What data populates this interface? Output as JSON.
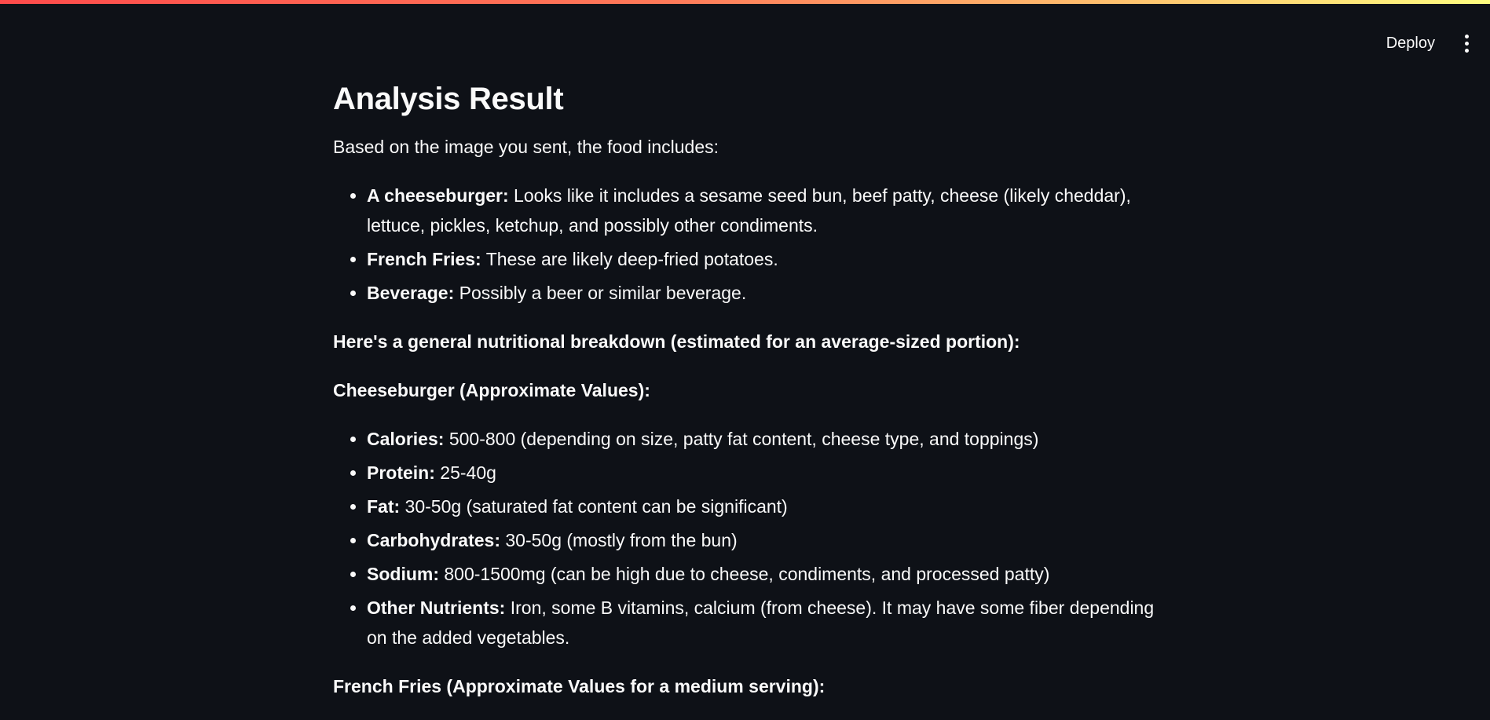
{
  "header": {
    "deploy_label": "Deploy",
    "menu_icon": "vertical-ellipsis-icon",
    "decoration_colors": [
      "#ff4b4b",
      "#fffd80"
    ]
  },
  "main": {
    "title": "Analysis Result",
    "intro": "Based on the image you sent, the food includes:",
    "foods": [
      {
        "label": "A cheeseburger:",
        "text": " Looks like it includes a sesame seed bun, beef patty, cheese (likely cheddar), lettuce, pickles, ketchup, and possibly other condiments."
      },
      {
        "label": "French Fries:",
        "text": " These are likely deep-fried potatoes."
      },
      {
        "label": "Beverage:",
        "text": " Possibly a beer or similar beverage."
      }
    ],
    "breakdown_heading": "Here's a general nutritional breakdown (estimated for an average-sized portion):",
    "cheeseburger_heading": "Cheeseburger (Approximate Values):",
    "cheeseburger_items": [
      {
        "label": "Calories:",
        "text": " 500-800 (depending on size, patty fat content, cheese type, and toppings)"
      },
      {
        "label": "Protein:",
        "text": " 25-40g"
      },
      {
        "label": "Fat:",
        "text": " 30-50g (saturated fat content can be significant)"
      },
      {
        "label": "Carbohydrates:",
        "text": " 30-50g (mostly from the bun)"
      },
      {
        "label": "Sodium:",
        "text": " 800-1500mg (can be high due to cheese, condiments, and processed patty)"
      },
      {
        "label": "Other Nutrients:",
        "text": " Iron, some B vitamins, calcium (from cheese). It may have some fiber depending on the added vegetables."
      }
    ],
    "fries_heading": "French Fries (Approximate Values for a medium serving):"
  }
}
